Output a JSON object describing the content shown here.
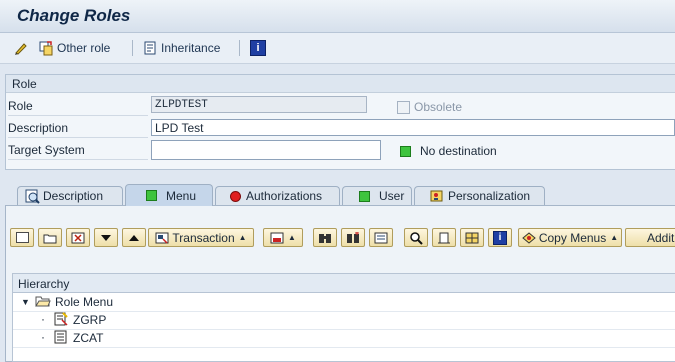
{
  "window": {
    "title": "Change Roles"
  },
  "toolbar": {
    "other_role": "Other role",
    "inheritance": "Inheritance",
    "info_icon_glyph": "i"
  },
  "role_section": {
    "header": "Role",
    "role_label": "Role",
    "role_value": "ZLPDTEST",
    "obsolete_label": "Obsolete",
    "description_label": "Description",
    "description_value": "LPD Test",
    "target_label": "Target System",
    "target_value": "",
    "status_text": "No destination"
  },
  "tabs": [
    {
      "label": "Description",
      "icon": "description-icon"
    },
    {
      "label": "Menu",
      "icon": "green-light-icon",
      "active": true
    },
    {
      "label": "Authorizations",
      "icon": "red-light-icon"
    },
    {
      "label": "User",
      "icon": "green-light-icon"
    },
    {
      "label": "Personalization",
      "icon": "personalization-icon"
    }
  ],
  "menu_toolbar": {
    "transaction": "Transaction",
    "copy_menus": "Copy Menus",
    "additional": "Additi"
  },
  "hierarchy": {
    "header": "Hierarchy",
    "root": "Role Menu",
    "items": [
      "ZGRP",
      "ZCAT"
    ]
  },
  "colors": {
    "status_green": "#3ec43e",
    "status_red": "#e02020",
    "button_fill": "#eedfa9"
  }
}
